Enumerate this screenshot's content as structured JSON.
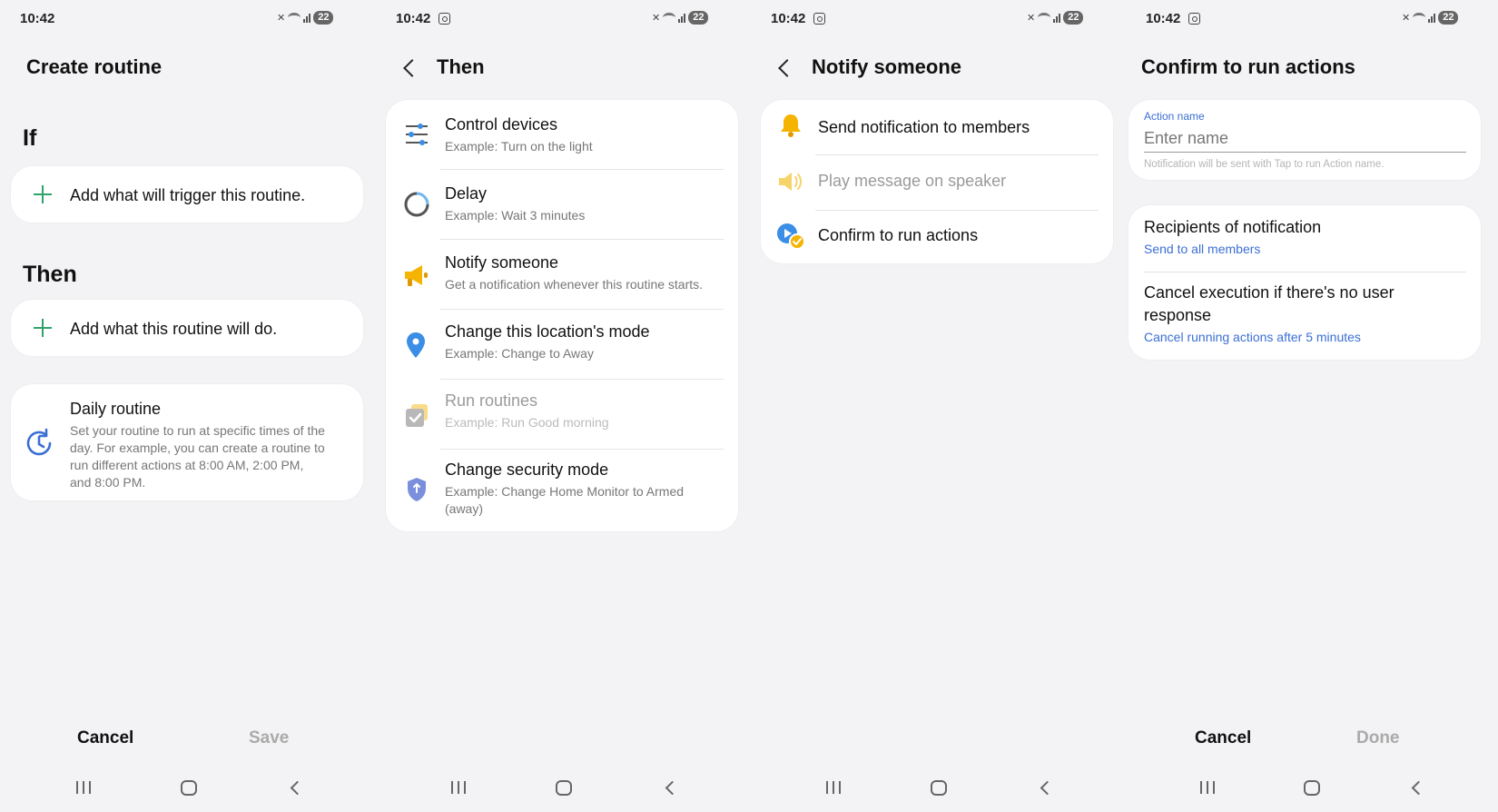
{
  "status_time": "10:42",
  "battery": "22",
  "screen1": {
    "title": "Create routine",
    "if_label": "If",
    "if_add": "Add what will trigger this routine.",
    "then_label": "Then",
    "then_add": "Add what this routine will do.",
    "daily_title": "Daily routine",
    "daily_desc_lines": [
      "Set your routine to run at specific times of the",
      "day. For example, you can create a routine to",
      "run different actions at 8:00 AM, 2:00 PM,",
      "and 8:00 PM."
    ],
    "cancel": "Cancel",
    "save": "Save"
  },
  "screen2": {
    "title": "Then",
    "items": [
      {
        "title": "Control devices",
        "sub": "Example: Turn on the light",
        "icon": "sliders-icon"
      },
      {
        "title": "Delay",
        "sub": "Example: Wait 3 minutes",
        "icon": "timer-icon"
      },
      {
        "title": "Notify someone",
        "sub": "Get a notification whenever this routine starts.",
        "icon": "megaphone-icon"
      },
      {
        "title": "Change this location's mode",
        "sub": "Example: Change to Away",
        "icon": "location-pin-icon"
      },
      {
        "title": "Run routines",
        "sub": "Example: Run Good morning",
        "icon": "routine-check-icon"
      },
      {
        "title": "Change security mode",
        "sub_lines": [
          "Example: Change Home Monitor to Armed",
          "(away)"
        ],
        "icon": "shield-icon"
      }
    ]
  },
  "screen3": {
    "title": "Notify someone",
    "items": [
      {
        "label": "Send notification to members",
        "icon": "bell-icon"
      },
      {
        "label": "Play message on speaker",
        "icon": "speaker-icon"
      },
      {
        "label": "Confirm to run actions",
        "icon": "confirm-play-icon"
      }
    ]
  },
  "screen4": {
    "title": "Confirm to run actions",
    "field_label": "Action name",
    "field_placeholder": "Enter name",
    "field_hint": "Notification will be sent with Tap to run Action name.",
    "recipients_title": "Recipients of notification",
    "recipients_value": "Send to all members",
    "cancel_title_lines": [
      "Cancel execution if there's no user",
      "response"
    ],
    "cancel_value": "Cancel running actions after 5 minutes",
    "cancel": "Cancel",
    "done": "Done"
  },
  "colors": {
    "accent_green": "#2fa36b",
    "accent_blue": "#3b6fd4",
    "warning_yellow": "#f5b400",
    "location_blue": "#3a8ee6"
  }
}
